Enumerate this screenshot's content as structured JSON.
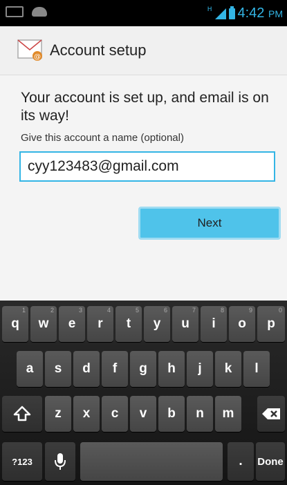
{
  "status_bar": {
    "time": "4:42",
    "ampm": "PM",
    "network_type": "H",
    "icons": [
      "keyboard-icon",
      "android-icon",
      "signal-icon",
      "battery-icon"
    ],
    "accent_color": "#33b5e5"
  },
  "action_bar": {
    "title": "Account setup",
    "icon": "email-app-icon"
  },
  "content": {
    "headline": "Your account is set up, and email is on its way!",
    "subline": "Give this account a name (optional)",
    "name_field_value": "cyy123483@gmail.com",
    "next_label": "Next"
  },
  "keyboard": {
    "row1": [
      {
        "key": "q",
        "hint": "1"
      },
      {
        "key": "w",
        "hint": "2"
      },
      {
        "key": "e",
        "hint": "3"
      },
      {
        "key": "r",
        "hint": "4"
      },
      {
        "key": "t",
        "hint": "5"
      },
      {
        "key": "y",
        "hint": "6"
      },
      {
        "key": "u",
        "hint": "7"
      },
      {
        "key": "i",
        "hint": "8"
      },
      {
        "key": "o",
        "hint": "9"
      },
      {
        "key": "p",
        "hint": "0"
      }
    ],
    "row2": [
      "a",
      "s",
      "d",
      "f",
      "g",
      "h",
      "j",
      "k",
      "l"
    ],
    "row3": [
      "z",
      "x",
      "c",
      "v",
      "b",
      "n",
      "m"
    ],
    "shift_icon": "shift-icon",
    "backspace_icon": "backspace-icon",
    "symbols_label": "?123",
    "mic_icon": "microphone-icon",
    "period_label": ".",
    "done_label": "Done"
  }
}
